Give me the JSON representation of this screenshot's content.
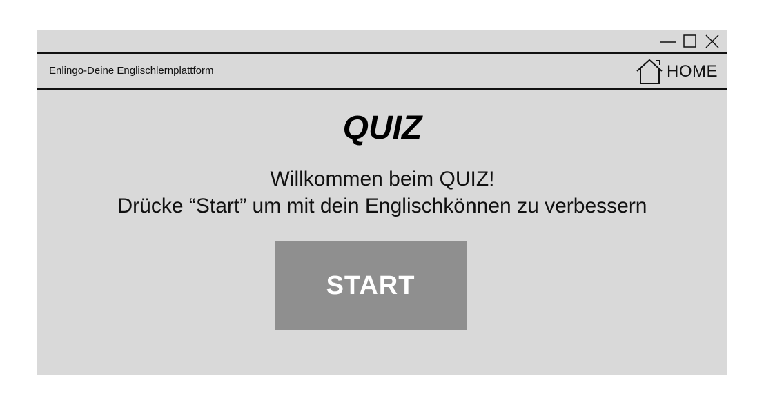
{
  "window": {
    "controls": {
      "minimize_icon": "minimize-icon",
      "maximize_icon": "maximize-icon",
      "close_icon": "close-icon"
    }
  },
  "navbar": {
    "brand": "Enlingo-Deine Englischlernplattform",
    "home_icon": "home-icon",
    "home_label": "HOME"
  },
  "main": {
    "title": "QUIZ",
    "welcome_line1": "Willkommen beim QUIZ!",
    "welcome_line2": "Drücke “Start” um mit dein Englischkönnen zu verbessern",
    "start_label": "START"
  },
  "colors": {
    "window_bg": "#d9d9d9",
    "button_bg": "#8f8f8f",
    "button_text": "#ffffff",
    "text": "#111111"
  }
}
